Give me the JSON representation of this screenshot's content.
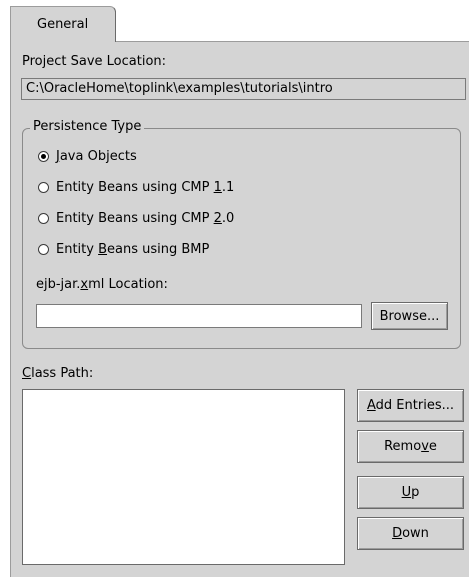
{
  "tabs": [
    {
      "label": "General",
      "selected": true
    }
  ],
  "project": {
    "save_location_label": "Project Save Location:",
    "save_location_value": "C:\\OracleHome\\toplink\\examples\\tutorials\\intro"
  },
  "persistence": {
    "title": "Persistence Type",
    "options": [
      {
        "label": "Java Objects",
        "checked": true
      },
      {
        "label": "Entity Beans using CMP 1.1",
        "checked": false
      },
      {
        "label": "Entity Beans using CMP 2.0",
        "checked": false
      },
      {
        "label": "Entity Beans using BMP",
        "checked": false
      }
    ],
    "ejb_location_label": "ejb-jar.xml Location:",
    "ejb_location_value": "",
    "browse_label": "Browse..."
  },
  "classpath": {
    "label": "Class Path:",
    "entries": [],
    "add_label": "Add Entries...",
    "remove_label": "Remove",
    "up_label": "Up",
    "down_label": "Down"
  }
}
